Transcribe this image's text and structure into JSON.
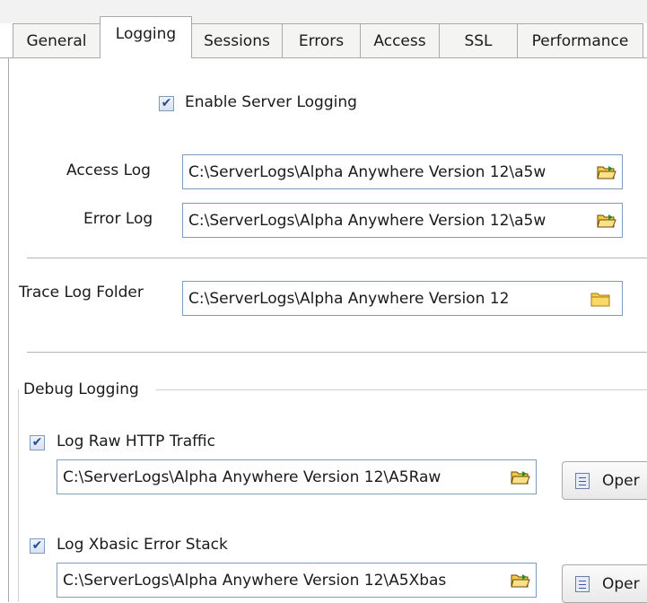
{
  "tabs": [
    "General",
    "Logging",
    "Sessions",
    "Errors",
    "Access",
    "SSL",
    "Performance"
  ],
  "enable_logging": {
    "label": "Enable Server Logging",
    "checked": true
  },
  "access_log": {
    "label": "Access Log",
    "value": "C:\\ServerLogs\\Alpha Anywhere Version 12\\a5w"
  },
  "error_log": {
    "label": "Error Log",
    "value": "C:\\ServerLogs\\Alpha Anywhere Version 12\\a5w"
  },
  "trace_log": {
    "label": "Trace Log Folder",
    "value": "C:\\ServerLogs\\Alpha Anywhere Version 12"
  },
  "debug": {
    "group_label": "Debug Logging",
    "raw_http": {
      "label": "Log Raw HTTP Traffic",
      "checked": true,
      "value": "C:\\ServerLogs\\Alpha Anywhere Version 12\\A5Raw",
      "open_label": "Oper"
    },
    "xbasic": {
      "label": "Log Xbasic Error Stack",
      "checked": true,
      "value": "C:\\ServerLogs\\Alpha Anywhere Version 12\\A5Xbas",
      "open_label": "Oper"
    }
  },
  "icons": {
    "file_browse": "open-folder-icon",
    "folder_browse": "folder-icon",
    "open_file": "document-icon"
  },
  "colors": {
    "check_accent": "#2a4a8c",
    "field_border": "#7f9db9",
    "folder_yellow": "#f5cc45"
  }
}
